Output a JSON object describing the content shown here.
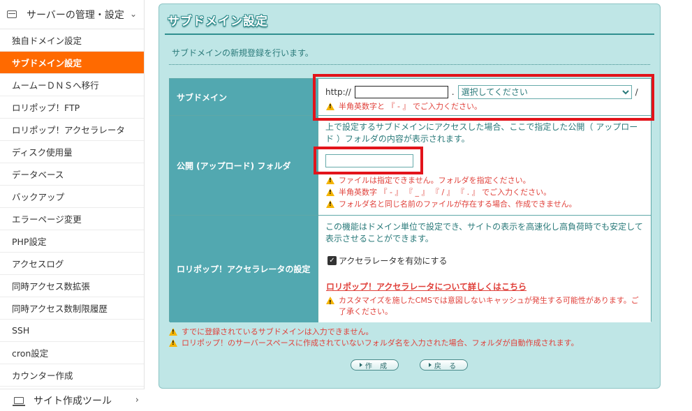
{
  "sidebar": {
    "group_top": "サーバーの管理・設定",
    "items": [
      {
        "label": "独自ドメイン設定",
        "active": false
      },
      {
        "label": "サブドメイン設定",
        "active": true
      },
      {
        "label": "ムームーＤＮＳへ移行",
        "active": false
      },
      {
        "label": "ロリポップ！FTP",
        "active": false
      },
      {
        "label": "ロリポップ！アクセラレータ",
        "active": false
      },
      {
        "label": "ディスク使用量",
        "active": false
      },
      {
        "label": "データベース",
        "active": false
      },
      {
        "label": "バックアップ",
        "active": false
      },
      {
        "label": "エラーページ変更",
        "active": false
      },
      {
        "label": "PHP設定",
        "active": false
      },
      {
        "label": "アクセスログ",
        "active": false
      },
      {
        "label": "同時アクセス数拡張",
        "active": false
      },
      {
        "label": "同時アクセス数制限履歴",
        "active": false
      },
      {
        "label": "SSH",
        "active": false
      },
      {
        "label": "cron設定",
        "active": false
      },
      {
        "label": "カウンター作成",
        "active": false
      }
    ],
    "group_bottom": "サイト作成ツール"
  },
  "panel": {
    "title": "サブドメイン設定",
    "intro": "サブドメインの新規登録を行います。"
  },
  "form": {
    "subdomain": {
      "label": "サブドメイン",
      "prefix": "http://",
      "input_value": "",
      "dot": ".",
      "select_value": "選択してください",
      "suffix": "/",
      "warning": "半角英数字と 『 - 』 でご入力ください。"
    },
    "folder": {
      "label": "公開 (アップロード) フォルダ",
      "description": "上で設定するサブドメインにアクセスした場合、ここで指定した公開（ アップロード ）フォルダの内容が表示されます。",
      "input_value": "",
      "warnings": [
        "ファイルは指定できません。フォルダを指定ください。",
        "半角英数字 『 - 』 『 _ 』 『 / 』 『 . 』 でご入力ください。",
        "フォルダ名と同じ名前のファイルが存在する場合、作成できません。"
      ]
    },
    "accelerator": {
      "label": "ロリポップ！アクセラレータの設定",
      "description": "この機能はドメイン単位で設定でき、サイトの表示を高速化し高負荷時でも安定して表示させることができます。",
      "checkbox_label": "アクセラレータを有効にする",
      "checked": true,
      "link": "ロリポップ！アクセラレータについて詳しくはこちら",
      "warning": "カスタマイズを施したCMSでは意図しないキャッシュが発生する可能性があります。ご了承ください。"
    }
  },
  "notes": [
    "すでに登録されているサブドメインは入力できません。",
    "ロリポップ！のサーバースペースに作成されていないフォルダ名を入力された場合、フォルダが自動作成されます。"
  ],
  "buttons": {
    "create": "作 成",
    "back": "戻 る"
  },
  "colors": {
    "accent": "#ff6a00",
    "panel_bg": "#bfe6e6",
    "label_bg": "#52a8b0",
    "warning_text": "#e0403a",
    "highlight_box": "#e2141b"
  }
}
